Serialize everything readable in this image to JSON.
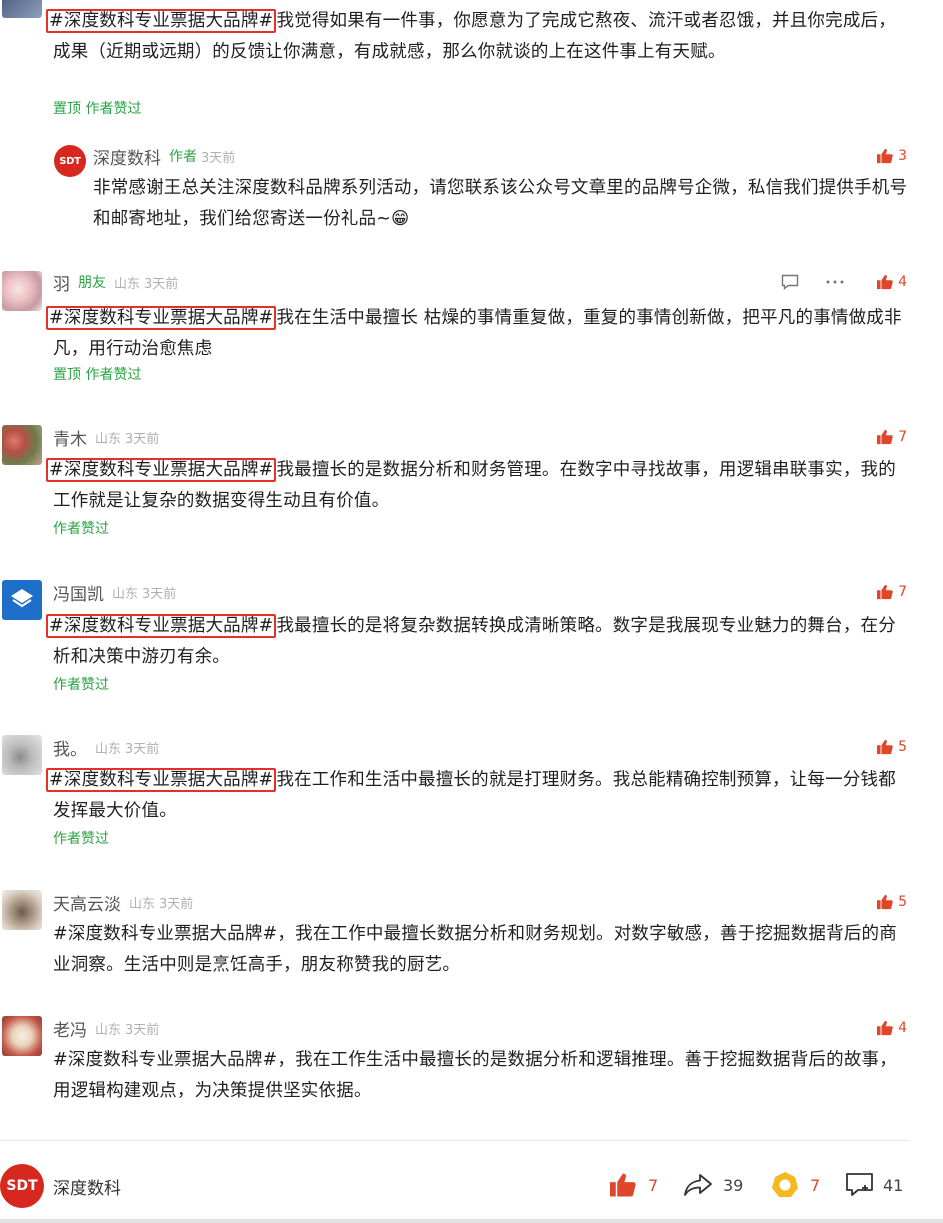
{
  "hashtag": "#深度数科专业票据大品牌#",
  "comments": [
    {
      "rest": "我觉得如果有一件事，你愿意为了完成它熬夜、流汗或者忍饿，并且你完成后，成果（近期或远期）的反馈让你满意，有成就感，那么你就谈的上在这件事上有天赋。",
      "sub": "置顶 作者赞过",
      "reply": {
        "name": "深度数科",
        "author_tag": "作者",
        "time": "3天前",
        "likes": "3",
        "text": "非常感谢王总关注深度数科品牌系列活动，请您联系该公众号文章里的品牌号企微，私信我们提供手机号和邮寄地址，我们给您寄送一份礼品~😁"
      }
    },
    {
      "name": "羽",
      "friend_tag": "朋友",
      "loc": "山东",
      "time": "3天前",
      "likes": "4",
      "rest": "我在生活中最擅长  枯燥的事情重复做，重复的事情创新做，把平凡的事情做成非凡，用行动治愈焦虑",
      "sub": "置顶 作者赞过"
    },
    {
      "name": "青木",
      "loc": "山东",
      "time": "3天前",
      "likes": "7",
      "rest": "我最擅长的是数据分析和财务管理。在数字中寻找故事，用逻辑串联事实，我的工作就是让复杂的数据变得生动且有价值。",
      "sub": "作者赞过"
    },
    {
      "name": "冯国凯",
      "loc": "山东",
      "time": "3天前",
      "likes": "7",
      "rest": "我最擅长的是将复杂数据转换成清晰策略。数字是我展现专业魅力的舞台，在分析和决策中游刃有余。",
      "sub": "作者赞过"
    },
    {
      "name": "我。",
      "loc": "山东",
      "time": "3天前",
      "likes": "5",
      "rest": "我在工作和生活中最擅长的就是打理财务。我总能精确控制预算，让每一分钱都发挥最大价值。",
      "sub": "作者赞过"
    },
    {
      "name": "天高云淡",
      "loc": "山东",
      "time": "3天前",
      "likes": "5",
      "text": "#深度数科专业票据大品牌#，我在工作中最擅长数据分析和财务规划。对数字敏感，善于挖掘数据背后的商业洞察。生活中则是烹饪高手，朋友称赞我的厨艺。"
    },
    {
      "name": "老冯",
      "loc": "山东",
      "time": "3天前",
      "likes": "4",
      "text": "#深度数科专业票据大品牌#，我在工作生活中最擅长的是数据分析和逻辑推理。善于挖掘数据背后的故事，用逻辑构建观点，为决策提供坚实依据。"
    }
  ],
  "footer": {
    "logo_text": "SDT",
    "account_name": "深度数科",
    "likes": "7",
    "shares": "39",
    "wows": "7",
    "comments": "41"
  },
  "reply_logo_text": "SDT",
  "colors": {
    "accent_red": "#e53025",
    "green": "#2aa444",
    "like_orange": "#e0472a",
    "wow_yellow": "#f5b820"
  },
  "icons": [
    "thumb-up-icon",
    "comment-icon",
    "more-icon",
    "share-icon",
    "wow-icon"
  ]
}
